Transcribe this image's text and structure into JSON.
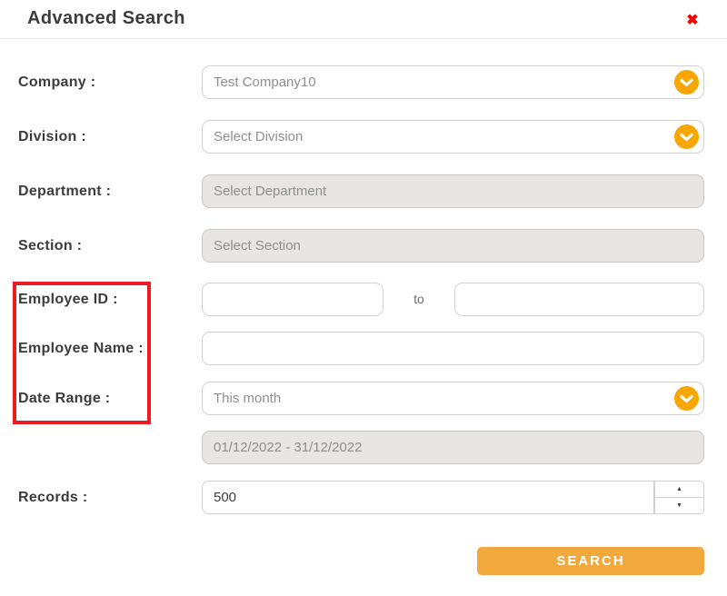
{
  "header": {
    "title": "Advanced Search"
  },
  "icons": {
    "close": "✖",
    "chevron_down": "⌄",
    "spinner_up": "▲",
    "spinner_down": "▼"
  },
  "fields": {
    "company": {
      "label": "Company :",
      "value": "Test Company10"
    },
    "division": {
      "label": "Division :",
      "value": "Select Division"
    },
    "department": {
      "label": "Department :",
      "value": "Select Department"
    },
    "section": {
      "label": "Section :",
      "value": "Select Section"
    },
    "employee_id": {
      "label": "Employee ID :",
      "from_value": "",
      "separator": "to",
      "to_value": ""
    },
    "employee_name": {
      "label": "Employee Name :",
      "value": ""
    },
    "date_range": {
      "label": "Date Range :",
      "value": "This month"
    },
    "date_range_result": {
      "value": "01/12/2022 - 31/12/2022"
    },
    "records": {
      "label": "Records :",
      "value": "500"
    }
  },
  "actions": {
    "search": "SEARCH"
  },
  "colors": {
    "accent_orange": "#F9A602",
    "button_orange": "#F1A83C",
    "close_red": "#F40000",
    "annotation_red": "#ED1C24"
  }
}
